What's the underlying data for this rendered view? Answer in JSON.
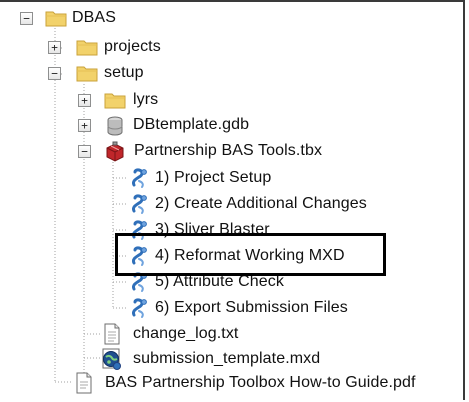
{
  "tree": {
    "root": {
      "label": "DBAS",
      "expanded": true,
      "icon": "folder-icon"
    },
    "projects": {
      "label": "projects",
      "expanded": false,
      "icon": "folder-icon"
    },
    "setup": {
      "label": "setup",
      "expanded": true,
      "icon": "folder-icon"
    },
    "lyrs": {
      "label": "lyrs",
      "expanded": false,
      "icon": "folder-icon"
    },
    "dbtemplate": {
      "label": "DBtemplate.gdb",
      "expanded": false,
      "icon": "geodatabase-icon"
    },
    "toolbox": {
      "label": "Partnership BAS Tools.tbx",
      "expanded": true,
      "icon": "toolbox-icon"
    },
    "tools": [
      {
        "label": "1) Project Setup",
        "icon": "script-tool-icon"
      },
      {
        "label": "2) Create Additional Changes",
        "icon": "script-tool-icon"
      },
      {
        "label": "3) Sliver Blaster",
        "icon": "script-tool-icon"
      },
      {
        "label": "4) Reformat Working MXD",
        "icon": "script-tool-icon",
        "selected": true
      },
      {
        "label": "5) Attribute Check",
        "icon": "script-tool-icon"
      },
      {
        "label": "6) Export Submission Files",
        "icon": "script-tool-icon"
      }
    ],
    "changelog": {
      "label": "change_log.txt",
      "icon": "text-file-icon"
    },
    "template_mxd": {
      "label": "submission_template.mxd",
      "icon": "map-document-icon"
    },
    "guide": {
      "label": "BAS Partnership Toolbox How-to Guide.pdf",
      "icon": "pdf-file-icon"
    }
  },
  "colors": {
    "folder": "#f2d26b",
    "folder_dark": "#c9a23a",
    "tool_blue": "#2f6fb9",
    "toolbox_red": "#c0262a",
    "highlight_border": "#000000"
  }
}
